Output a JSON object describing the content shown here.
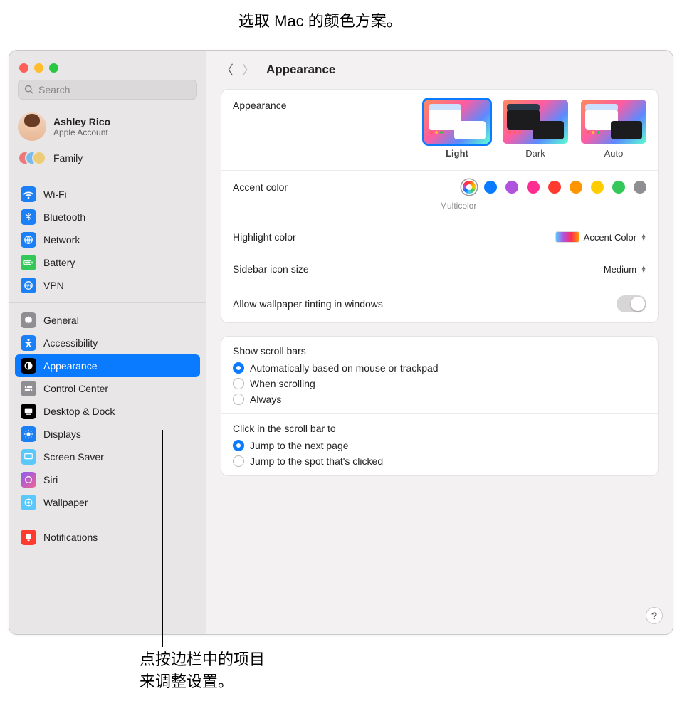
{
  "callouts": {
    "top": "选取 Mac 的颜色方案。",
    "bottom_l1": "点按边栏中的项目",
    "bottom_l2": "来调整设置。"
  },
  "search": {
    "placeholder": "Search"
  },
  "account": {
    "name": "Ashley Rico",
    "sub": "Apple Account",
    "family": "Family"
  },
  "sidebar": {
    "group1": {
      "wifi": "Wi-Fi",
      "bluetooth": "Bluetooth",
      "network": "Network",
      "battery": "Battery",
      "vpn": "VPN"
    },
    "group2": {
      "general": "General",
      "accessibility": "Accessibility",
      "appearance": "Appearance",
      "controlcenter": "Control Center",
      "desktopdock": "Desktop & Dock",
      "displays": "Displays",
      "screensaver": "Screen Saver",
      "siri": "Siri",
      "wallpaper": "Wallpaper"
    },
    "group3": {
      "notifications": "Notifications"
    }
  },
  "page": {
    "title": "Appearance"
  },
  "appearance": {
    "label": "Appearance",
    "light": "Light",
    "dark": "Dark",
    "auto": "Auto"
  },
  "accent": {
    "label": "Accent color",
    "selected_name": "Multicolor",
    "colors": {
      "blue": "#0a7aff",
      "purple": "#af52de",
      "pink": "#ff2d92",
      "red": "#ff3b30",
      "orange": "#ff9500",
      "yellow": "#ffcc00",
      "green": "#34c759",
      "graphite": "#8e8e93"
    }
  },
  "highlight": {
    "label": "Highlight color",
    "value": "Accent Color"
  },
  "sidebar_icon": {
    "label": "Sidebar icon size",
    "value": "Medium"
  },
  "tinting": {
    "label": "Allow wallpaper tinting in windows"
  },
  "scrollbars": {
    "title": "Show scroll bars",
    "opt1": "Automatically based on mouse or trackpad",
    "opt2": "When scrolling",
    "opt3": "Always"
  },
  "scrollclick": {
    "title": "Click in the scroll bar to",
    "opt1": "Jump to the next page",
    "opt2": "Jump to the spot that's clicked"
  },
  "help": "?"
}
